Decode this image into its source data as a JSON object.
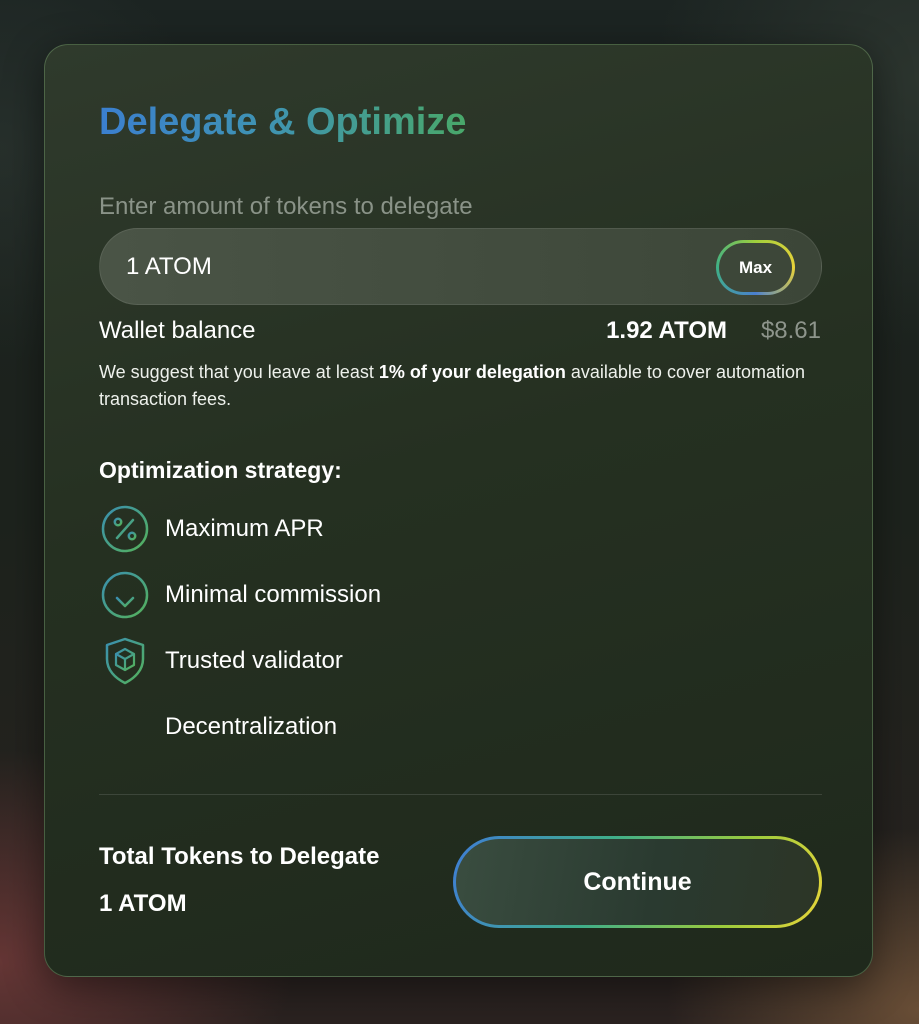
{
  "title": "Delegate & Optimize",
  "amount": {
    "label": "Enter amount of tokens to delegate",
    "value": "1 ATOM",
    "max_label": "Max"
  },
  "wallet": {
    "label": "Wallet balance",
    "amount": "1.92 ATOM",
    "usd": "$8.61"
  },
  "suggestion": {
    "prefix": "We suggest that you leave at least ",
    "emphasis": "1% of your delegation",
    "suffix": " available to cover automation transaction fees."
  },
  "strategy": {
    "heading": "Optimization strategy:",
    "items": [
      {
        "label": "Maximum APR",
        "icon": "percent-circle-icon"
      },
      {
        "label": "Minimal commission",
        "icon": "arrow-down-circle-icon"
      },
      {
        "label": "Trusted validator",
        "icon": "shield-cube-icon"
      },
      {
        "label": "Decentralization",
        "icon": "sliders-icon"
      }
    ]
  },
  "total": {
    "label": "Total Tokens to Delegate",
    "value": "1 ATOM"
  },
  "continue_label": "Continue",
  "colors": {
    "gradient_blue": "#3b7fcf",
    "gradient_green": "#49a86a",
    "gradient_yellow": "#e8d53a",
    "icon_green": "#4dab5c",
    "muted_text": "#8a9388"
  }
}
